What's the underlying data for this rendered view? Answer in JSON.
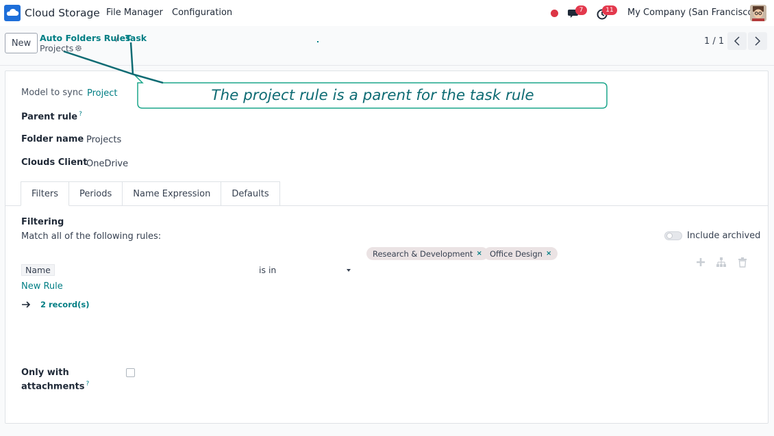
{
  "navbar": {
    "app_name": "Cloud Storage",
    "menu": [
      "File Manager",
      "Configuration"
    ],
    "chat_count": "7",
    "activity_count": "11",
    "company": "My Company (San Francisco)"
  },
  "control_panel": {
    "new_label": "New",
    "breadcrumb_parent": "Auto Folders Rules",
    "breadcrumb_separator": "/",
    "breadcrumb_child": "Task",
    "current_record": "Projects",
    "pager_value": "1 / 1"
  },
  "form": {
    "model_label": "Model to sync",
    "model_value": "Project",
    "parent_label": "Parent rule",
    "folder_label": "Folder name",
    "folder_value": "Projects",
    "client_label": "Clouds Client",
    "client_value": "OneDrive",
    "help_mark": "?"
  },
  "tabs": [
    "Filters",
    "Periods",
    "Name Expression",
    "Defaults"
  ],
  "filters": {
    "heading": "Filtering",
    "match_text": "Match all of the following rules:",
    "include_archived": "Include archived",
    "tags": [
      "Research & Development",
      "Office Design"
    ],
    "tag_remove": "×",
    "rule_field": "Name",
    "rule_operator": "is in",
    "new_rule": "New Rule",
    "records": "2 record(s)",
    "only_with_label_1": "Only with",
    "only_with_label_2": "attachments"
  },
  "annotation": {
    "text": "The project rule is a parent for the task rule"
  },
  "colors": {
    "accent": "#017e84",
    "badge": "#e3394d",
    "status_dot": "#dc3545",
    "callout": "#1aa58a"
  }
}
